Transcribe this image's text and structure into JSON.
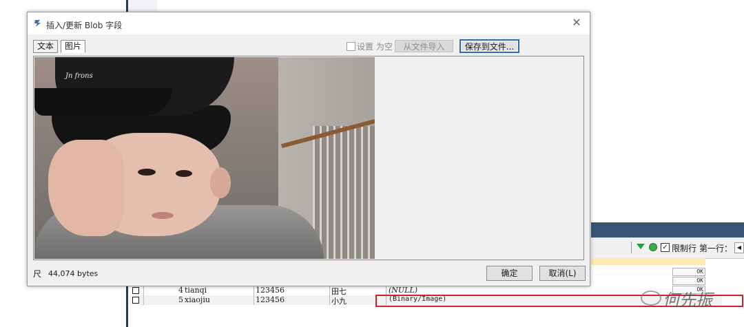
{
  "dialog": {
    "title": "插入/更新 Blob 字段",
    "tabs": [
      {
        "label": "文本",
        "active": false
      },
      {
        "label": "图片",
        "active": true
      }
    ],
    "set_null_label": "设置 为空",
    "set_null_checked": false,
    "import_button": "从文件导入",
    "save_button": "保存到文件...",
    "size_text": "44,074 bytes",
    "size_icon_glyph": "尺",
    "ok_button": "确定",
    "cancel_button": "取消(L)",
    "photo_logo_text": "Jn frons"
  },
  "toolbar": {
    "limit_rows_label": "限制行",
    "first_row_label": "第一行：",
    "limit_checked": true
  },
  "status_cells": [
    "OK",
    "OK",
    "OK"
  ],
  "rows": [
    {
      "id": "4",
      "name": "tianqi",
      "password": "123456",
      "cn_name": "田七",
      "blob": "(NULL)"
    },
    {
      "id": "5",
      "name": "xiaojiu",
      "password": "123456",
      "cn_name": "小九",
      "blob": "(Binary/Image)"
    }
  ],
  "watermark_text": "何先振",
  "colors": {
    "highlight": "#d81e25",
    "focus_border": "#2b6ac7",
    "grid_header": "#3a5478",
    "filter_icon": "#1f9e3b"
  }
}
